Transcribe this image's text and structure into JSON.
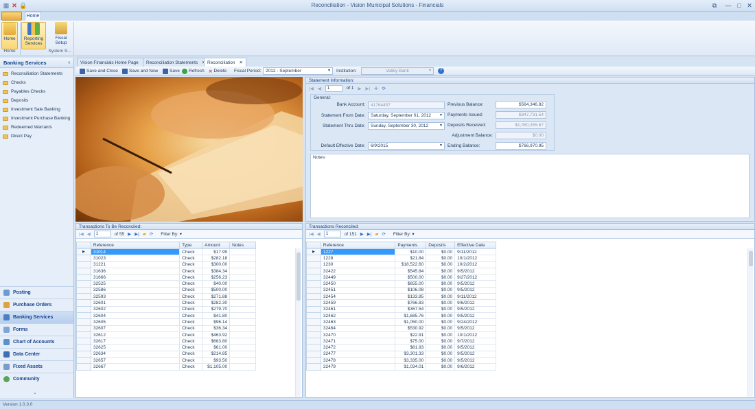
{
  "window": {
    "title": "Reconciliation - Vision Municipal Solutions - Financials"
  },
  "ribbon": {
    "tab_home": "Home",
    "buttons": [
      {
        "label": "Home"
      },
      {
        "label": "Reporting Services"
      },
      {
        "label": "Fiscal Setup"
      }
    ],
    "groups": {
      "home": "Home",
      "system": "System S..."
    }
  },
  "sidebar": {
    "header": "Banking Services",
    "items": [
      {
        "label": "Reconciliation Statements"
      },
      {
        "label": "Checks"
      },
      {
        "label": "Payables Checks"
      },
      {
        "label": "Deposits"
      },
      {
        "label": "Investment Sale Banking"
      },
      {
        "label": "Investment Purchase Banking"
      },
      {
        "label": "Redeemed Warrants"
      },
      {
        "label": "Direct Pay"
      }
    ],
    "nav": [
      {
        "label": "Posting"
      },
      {
        "label": "Purchase Orders"
      },
      {
        "label": "Banking Services"
      },
      {
        "label": "Forms"
      },
      {
        "label": "Chart of Accounts"
      },
      {
        "label": "Data Center"
      },
      {
        "label": "Fixed Assets"
      },
      {
        "label": "Community"
      }
    ]
  },
  "doc_tabs": [
    {
      "label": "Vision Financials Home Page"
    },
    {
      "label": "Reconciliation Statements"
    },
    {
      "label": "Reconciliation"
    }
  ],
  "toolbar": {
    "save_close": "Save and Close",
    "save_new": "Save and New",
    "save": "Save",
    "refresh": "Refresh",
    "delete": "Delete",
    "fiscal_label": "Fiscal Period:",
    "fiscal_value": "2012 - September",
    "institution_label": "Institution:",
    "institution_value": "Valley Bank"
  },
  "statement": {
    "panel_title": "Statement Information:",
    "nav_page": "1",
    "nav_of": "of 1",
    "general_label": "General:",
    "bank_account_label": "Bank Account:",
    "bank_account": "41764457",
    "from_label": "Statement From Date:",
    "from_value": "Saturday, September 01, 2012",
    "thru_label": "Statement Thru Date:",
    "thru_value": "Sunday, September 30, 2012",
    "default_label": "Default Effective Date:",
    "default_value": "6/9/2015",
    "prev_label": "Previous Balance:",
    "prev_value": "$564,346.82",
    "payments_label": "Payments Issued:",
    "payments_value": "$847,731.54",
    "deposits_label": "Deposits Received:",
    "deposits_value": "$1,050,355.67",
    "adjust_label": "Adjustment Balance:",
    "adjust_value": "$0.00",
    "ending_label": "Ending Balance:",
    "ending_value": "$766,970.95",
    "notes_label": "Notes:"
  },
  "to_reconcile": {
    "title": "Transactions To Be Reconciled:",
    "page": "1",
    "of": "of 55",
    "filter": "Filter By:",
    "columns": [
      "Reference",
      "Type",
      "Amount",
      "Notes"
    ],
    "rows": [
      [
        "31014",
        "Check",
        "$17.99",
        ""
      ],
      [
        "31023",
        "Check",
        "$282.18",
        ""
      ],
      [
        "31221",
        "Check",
        "$300.00",
        ""
      ],
      [
        "31636",
        "Check",
        "$384.34",
        ""
      ],
      [
        "31666",
        "Check",
        "$256.23",
        ""
      ],
      [
        "32525",
        "Check",
        "$40.00",
        ""
      ],
      [
        "32586",
        "Check",
        "$500.00",
        ""
      ],
      [
        "32593",
        "Check",
        "$271.88",
        ""
      ],
      [
        "32601",
        "Check",
        "$282.30",
        ""
      ],
      [
        "32602",
        "Check",
        "$279.70",
        ""
      ],
      [
        "32604",
        "Check",
        "$41.80",
        ""
      ],
      [
        "32605",
        "Check",
        "$96.14",
        ""
      ],
      [
        "32607",
        "Check",
        "$36.34",
        ""
      ],
      [
        "32612",
        "Check",
        "$463.92",
        ""
      ],
      [
        "32617",
        "Check",
        "$683.80",
        ""
      ],
      [
        "32625",
        "Check",
        "$61.00",
        ""
      ],
      [
        "32634",
        "Check",
        "$214.85",
        ""
      ],
      [
        "32657",
        "Check",
        "$93.50",
        ""
      ],
      [
        "32667",
        "Check",
        "$1,105.00",
        ""
      ]
    ]
  },
  "reconciled": {
    "title": "Transactions Reconciled:",
    "page": "1",
    "of": "of 151",
    "filter": "Filter By:",
    "columns": [
      "Reference",
      "Payments",
      "Deposits",
      "Effective Date"
    ],
    "rows": [
      [
        "1227",
        "$10.00",
        "$0.00",
        "9/11/2012"
      ],
      [
        "1228",
        "$21.84",
        "$0.00",
        "10/1/2012"
      ],
      [
        "1230",
        "$18,522.60",
        "$0.00",
        "10/2/2012"
      ],
      [
        "32422",
        "$545.84",
        "$0.00",
        "9/5/2012"
      ],
      [
        "32449",
        "$500.00",
        "$0.00",
        "9/27/2012"
      ],
      [
        "32450",
        "$655.00",
        "$0.00",
        "9/5/2012"
      ],
      [
        "32451",
        "$106.08",
        "$0.00",
        "9/5/2012"
      ],
      [
        "32454",
        "$133.95",
        "$0.00",
        "9/11/2012"
      ],
      [
        "32459",
        "$766.83",
        "$0.00",
        "9/6/2012"
      ],
      [
        "32461",
        "$367.54",
        "$0.00",
        "9/5/2012"
      ],
      [
        "32462",
        "$1,685.76",
        "$0.00",
        "9/5/2012"
      ],
      [
        "32463",
        "$1,050.00",
        "$0.00",
        "9/24/2012"
      ],
      [
        "32464",
        "$530.92",
        "$0.00",
        "9/5/2012"
      ],
      [
        "32470",
        "$22.91",
        "$0.00",
        "10/1/2012"
      ],
      [
        "32471",
        "$75.00",
        "$0.00",
        "9/7/2012"
      ],
      [
        "32472",
        "$81.93",
        "$0.00",
        "9/5/2012"
      ],
      [
        "32477",
        "$3,301.33",
        "$0.00",
        "9/5/2012"
      ],
      [
        "32478",
        "$3,335.00",
        "$0.00",
        "9/5/2012"
      ],
      [
        "32479",
        "$1,034.01",
        "$0.00",
        "9/6/2012"
      ]
    ]
  },
  "status": {
    "version": "Version 1.0.3.0"
  }
}
